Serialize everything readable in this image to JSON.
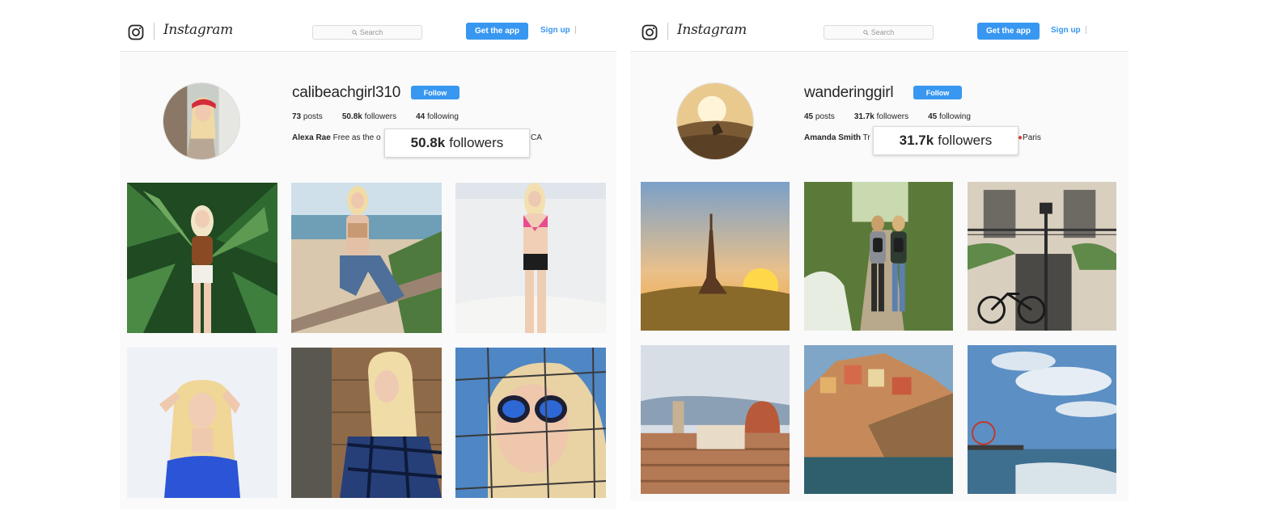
{
  "header": {
    "brand": "Instagram",
    "search_placeholder": "Search",
    "get_app_label": "Get the app",
    "signup_label": "Sign up"
  },
  "profiles": [
    {
      "username": "calibeachgirl310",
      "follow_label": "Follow",
      "posts_count": "73",
      "posts_label": "posts",
      "followers_count": "50.8k",
      "followers_label": "followers",
      "following_count": "44",
      "following_label": "following",
      "bio_name": "Alexa Rae",
      "bio_text_left": "Free as the o",
      "bio_text_right": "CA",
      "callout_count": "50.8k",
      "callout_label": "followers",
      "photos": [
        "palm-leaves-portrait",
        "beach-railing-jeans",
        "beach-pink-bikini",
        "white-wall-blue-top",
        "plaid-shirt-wood-wall",
        "sunglasses-fence-sky"
      ]
    },
    {
      "username": "wanderinggirl",
      "follow_label": "Follow",
      "posts_count": "45",
      "posts_label": "posts",
      "followers_count": "31.7k",
      "followers_label": "followers",
      "following_count": "45",
      "following_label": "following",
      "bio_name": "Amanda Smith",
      "bio_text_left": "Tr",
      "bio_text_right": "Paris",
      "callout_count": "31.7k",
      "callout_label": "followers",
      "photos": [
        "eiffel-tower-sunset",
        "two-hikers-backpacks",
        "paris-balcony-bicycle",
        "florence-duomo",
        "cinque-terre-cliffs",
        "pier-ocean-clouds"
      ]
    }
  ],
  "colors": {
    "accent": "#3897f0",
    "panel_bg": "#fafafa",
    "text": "#262626",
    "pin": "#e0413a"
  }
}
